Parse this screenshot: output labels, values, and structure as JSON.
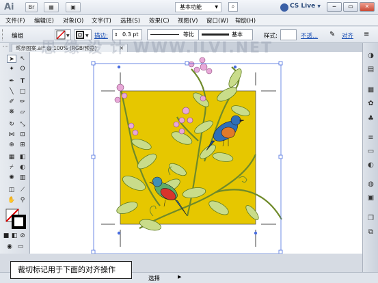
{
  "app": {
    "logo": "Ai",
    "bridge": "Br",
    "workspace": "基本功能",
    "workspace_arrow": "▼",
    "cs_live": "CS Live",
    "cs_live_arrow": "▼"
  },
  "window": {
    "minimize": "─",
    "maximize": "▭",
    "close": "✕"
  },
  "menu": [
    "文件(F)",
    "编辑(E)",
    "对象(O)",
    "文字(T)",
    "选择(S)",
    "效果(C)",
    "视图(V)",
    "窗口(W)",
    "帮助(H)"
  ],
  "control": {
    "label": "编组",
    "stroke_label": "描边:",
    "stroke_value": "0.3 pt",
    "profile": "等比",
    "brush": "基本",
    "style_label": "样式:",
    "opacity_label": "不透...",
    "align_label": "对齐"
  },
  "doc_tab": "鸳奈图案.ai* @ 100% (RGB/预览)",
  "doc_tab_close": "✕",
  "status": {
    "text": "选择",
    "arrow": "▶"
  },
  "caption": "裁切标记用于下面的对齐操作",
  "watermark": "思 缘 设 计  WWW.ILVI.NET",
  "colors": {
    "artboard": "#e8c800",
    "selection": "#4a6ee0"
  }
}
